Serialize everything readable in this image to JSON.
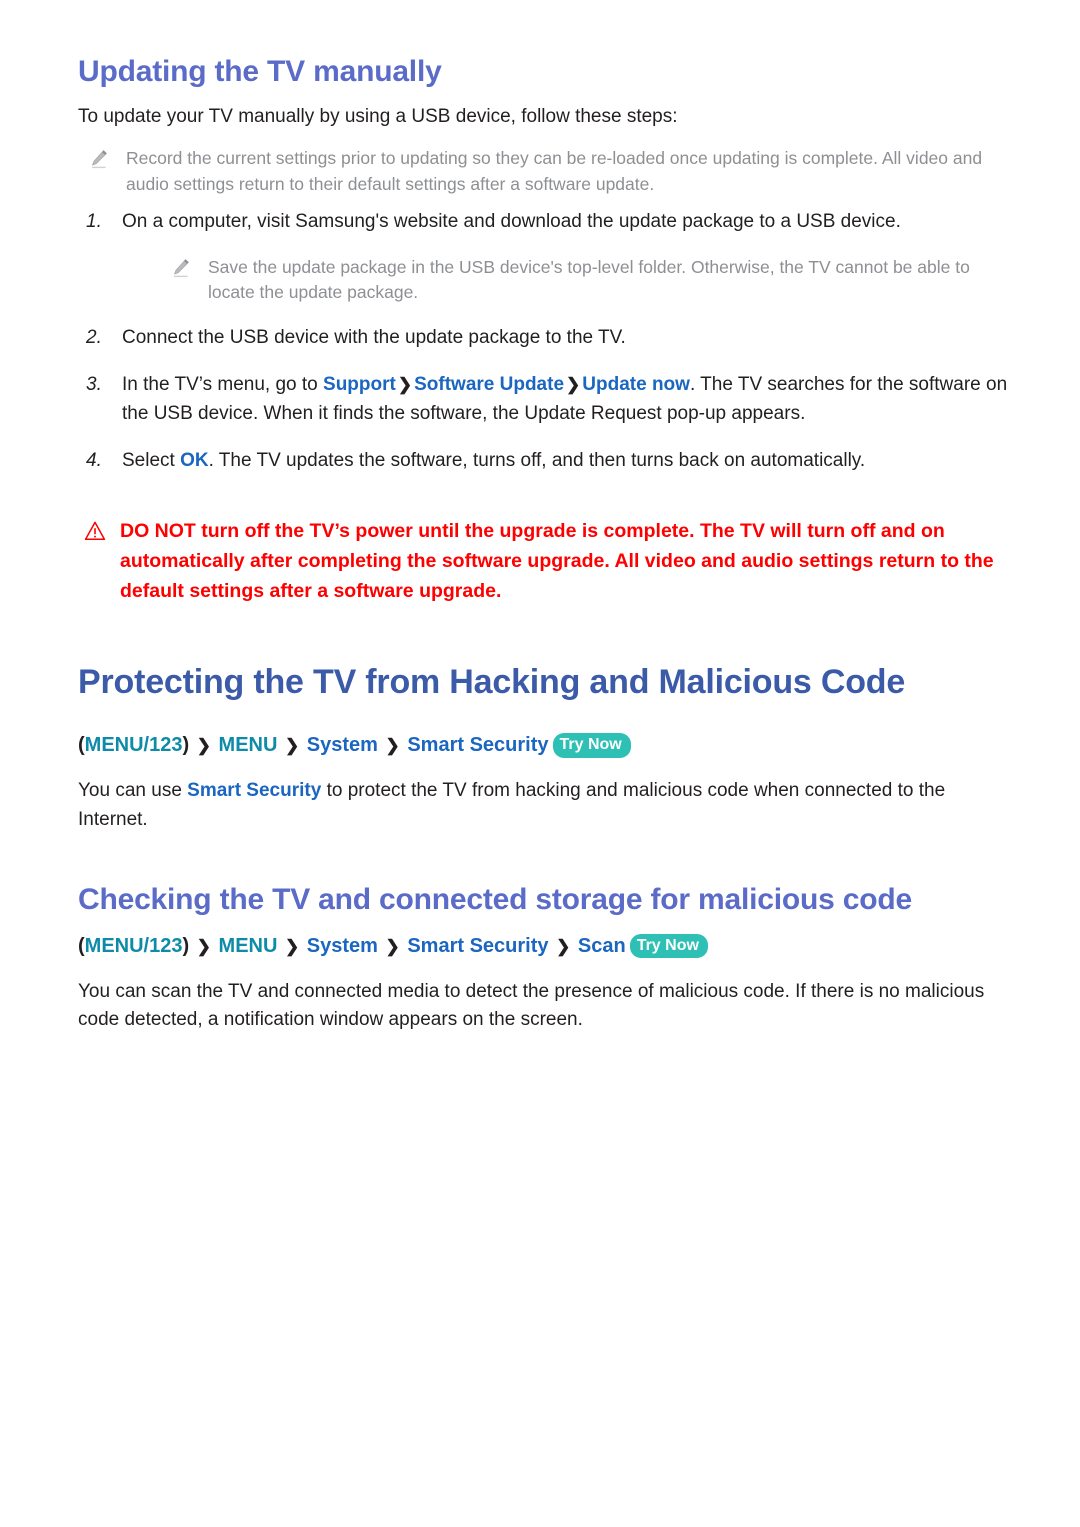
{
  "document": {
    "sections": [
      {
        "id": "updating-manually",
        "heading": "Updating the TV manually",
        "intro": "To update your TV manually by using a USB device, follow these steps:",
        "note": "Record the current settings prior to updating so they can be re-loaded once updating is complete. All video and audio settings return to their default settings after a software update.",
        "steps": [
          {
            "num": "1.",
            "text": "On a computer, visit Samsung's website and download the update package to a USB device.",
            "subnote": "Save the update package in the USB device's top-level folder. Otherwise, the TV cannot be able to locate the update package."
          },
          {
            "num": "2.",
            "text": "Connect the USB device with the update package to the TV."
          },
          {
            "num": "3.",
            "text_before": "In the TV’s menu, go to ",
            "links": [
              "Support",
              "Software Update",
              "Update now"
            ],
            "text_after": ". The TV searches for the software on the USB device. When it finds the software, the Update Request pop-up appears."
          },
          {
            "num": "4.",
            "text_before": "Select ",
            "links": [
              "OK"
            ],
            "text_after": ". The TV updates the software, turns off, and then turns back on automatically."
          }
        ],
        "warning": "DO NOT turn off the TV’s power until the upgrade is complete. The TV will turn off and on automatically after completing the software upgrade. All video and audio settings return to the default settings after a software upgrade."
      },
      {
        "id": "protecting-tv",
        "heading": "Protecting the TV from Hacking and Malicious Code",
        "breadcrumb": {
          "open_paren": "(",
          "menu123": "MENU/123",
          "close_paren": ")",
          "chevron": "❯",
          "items": [
            {
              "label": "MENU",
              "color": "teal"
            },
            {
              "label": "System",
              "color": "blue"
            },
            {
              "label": "Smart Security",
              "color": "blue"
            }
          ],
          "badge": "Try Now"
        },
        "paragraph_before": "You can use ",
        "paragraph_link": "Smart Security",
        "paragraph_after": " to protect the TV from hacking and malicious code when connected to the Internet."
      },
      {
        "id": "checking-malicious-code",
        "heading": "Checking the TV and connected storage for malicious code",
        "breadcrumb": {
          "open_paren": "(",
          "menu123": "MENU/123",
          "close_paren": ")",
          "chevron": "❯",
          "items": [
            {
              "label": "MENU",
              "color": "teal"
            },
            {
              "label": "System",
              "color": "blue"
            },
            {
              "label": "Smart Security",
              "color": "blue"
            },
            {
              "label": "Scan",
              "color": "blue"
            }
          ],
          "badge": "Try Now"
        },
        "paragraph": "You can scan the TV and connected media to detect the presence of malicious code. If there is no malicious code detected, a notification window appears on the screen."
      }
    ],
    "colors": {
      "heading_h2": "#5b6bc8",
      "heading_h1": "#3b5aa8",
      "link_blue": "#1a66c0",
      "breadcrumb_teal": "#0e8ba8",
      "badge_teal": "#2fc0b5",
      "warning_red": "#ff0000",
      "note_gray": "#8d8f93",
      "body_text": "#231f20"
    }
  }
}
